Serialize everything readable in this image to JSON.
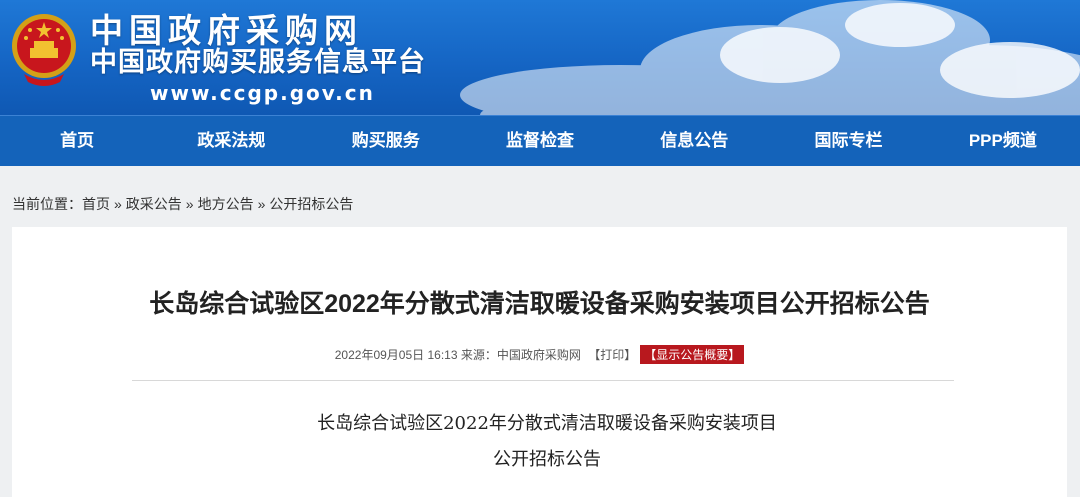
{
  "header": {
    "title": "中国政府采购网",
    "subtitle": "中国政府购买服务信息平台",
    "url": "www.ccgp.gov.cn",
    "emblem_icon": "national-emblem-icon"
  },
  "nav": {
    "items": [
      {
        "label": "首页"
      },
      {
        "label": "政采法规"
      },
      {
        "label": "购买服务"
      },
      {
        "label": "监督检查"
      },
      {
        "label": "信息公告"
      },
      {
        "label": "国际专栏"
      },
      {
        "label": "PPP频道"
      }
    ]
  },
  "breadcrumb": {
    "prefix": "当前位置：",
    "items": [
      "首页",
      "政采公告",
      "地方公告",
      "公开招标公告"
    ],
    "separator": "»"
  },
  "article": {
    "title": "长岛综合试验区2022年分散式清洁取暖设备采购安装项目公开招标公告",
    "date": "2022年09月05日 16:13",
    "source": "来源：中国政府采购网",
    "print_label": "【打印】",
    "summary_label": "【显示公告概要】",
    "body_line1": "长岛综合试验区2022年分散式清洁取暖设备采购安装项目",
    "body_line2": "公开招标公告"
  },
  "colors": {
    "banner": "#1565c4",
    "nav": "#1463ba",
    "summary_button": "#b8181e",
    "page_bg": "#eef0f2"
  }
}
